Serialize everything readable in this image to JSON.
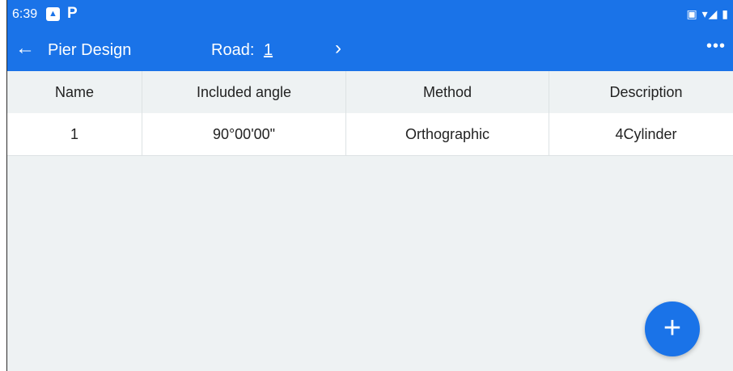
{
  "status": {
    "time": "6:39",
    "icons": [
      "gallery-icon",
      "parking-icon",
      "cast-icon",
      "wifi-icon",
      "signal-icon",
      "battery-icon"
    ],
    "right_glyphs": "▣ ▾◢ ▮"
  },
  "toolbar": {
    "back_glyph": "←",
    "title": "Pier Design",
    "road_label": "Road:",
    "road_value": "1",
    "next_glyph": "›",
    "more_glyph": "•••"
  },
  "table": {
    "headers": [
      "Name",
      "Included angle",
      "Method",
      "Description"
    ],
    "rows": [
      [
        "1",
        "90°00'00\"",
        "Orthographic",
        "4Cylinder"
      ]
    ]
  },
  "fab": {
    "glyph": "+"
  },
  "colors": {
    "accent": "#1a73e8",
    "background": "#eef2f3"
  }
}
